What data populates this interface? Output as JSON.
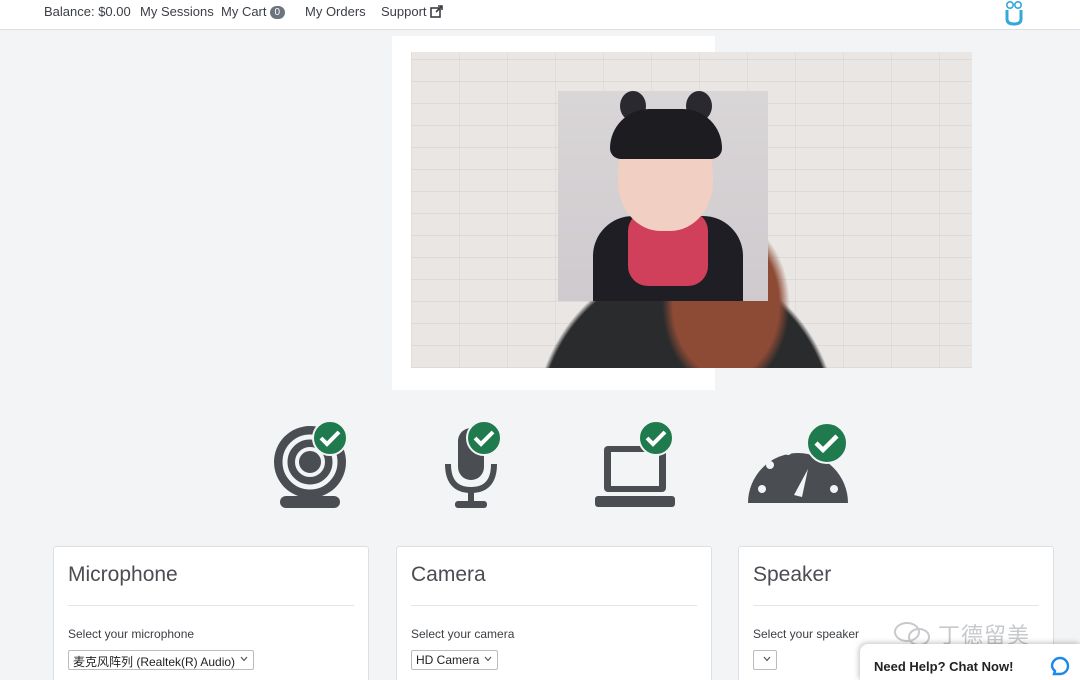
{
  "nav": {
    "balance": "Balance: $0.00",
    "sessions": "My Sessions",
    "cart": "My Cart",
    "cart_count": "0",
    "orders": "My Orders",
    "support": "Support"
  },
  "devices": [
    {
      "name": "webcam-icon",
      "status": "ok"
    },
    {
      "name": "microphone-icon",
      "status": "ok"
    },
    {
      "name": "laptop-icon",
      "status": "ok"
    },
    {
      "name": "speedometer-icon",
      "status": "ok"
    }
  ],
  "cards": {
    "microphone": {
      "title": "Microphone",
      "label": "Select your microphone",
      "selected": "麦克风阵列 (Realtek(R) Audio)"
    },
    "camera": {
      "title": "Camera",
      "label": "Select your camera",
      "selected": "HD Camera"
    },
    "speaker": {
      "title": "Speaker",
      "label": "Select your speaker",
      "selected": ""
    }
  },
  "watermark": "丁德留美",
  "chat": {
    "label": "Need Help? Chat Now!"
  },
  "colors": {
    "check": "#1f7a4d",
    "icon": "#4a4d52",
    "chat_accent": "#1e88e5"
  }
}
